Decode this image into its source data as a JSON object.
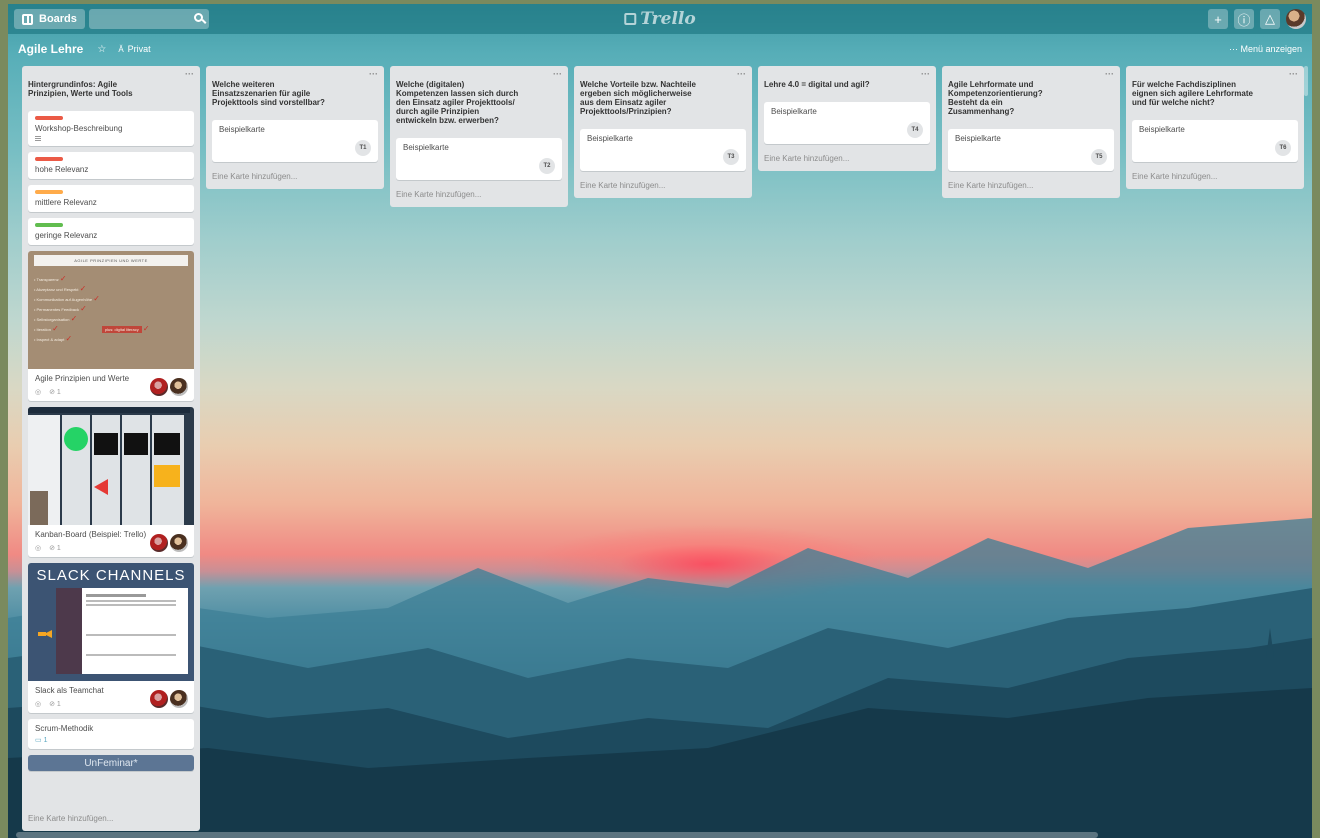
{
  "header": {
    "boards_label": "Boards",
    "search_value": "",
    "logo_text": "Trello",
    "plus_label": "+",
    "info_label": "ⓘ",
    "bell_label": "△"
  },
  "board": {
    "title": "Agile Lehre",
    "star": "☆",
    "privacy_icon": "Ă",
    "privacy": "Privat",
    "menu_link": "··· Menü anzeigen"
  },
  "colors": {
    "label_red": "#eb5a46",
    "label_orange": "#ffab4a",
    "label_green": "#61bd4f",
    "list_bg": "#e2e4e6"
  },
  "lists": [
    {
      "title": "Hintergrundinfos: Agile\nPrinzipien, Werte und Tools",
      "cards": {
        "workshop": "Workshop-Beschreibung",
        "hoch": "hohe Relevanz",
        "mittel": "mittlere Relevanz",
        "gering": "geringe Relevanz",
        "prinzipien_cover_title": "AGILE PRINZIPIEN UND WERTE",
        "prinzipien_items": [
          "Transparenz",
          "Akzeptanz und Respekt",
          "Kommunikation auf Augenhöhe",
          "Permanentes Feedback",
          "Selbstorganisation",
          "Iteration",
          "Inspect & adapt"
        ],
        "prinzipien_pill": "plus: digital literacy",
        "prinzipien": "Agile Prinzipien und Werte",
        "prinzipien_attach": "1",
        "kanban": "Kanban-Board (Beispiel: Trello)",
        "kanban_attach": "1",
        "slack_cover_title": "SLACK CHANNELS",
        "slack": "Slack als Teamchat",
        "slack_attach": "1",
        "scrum": "Scrum-Methodik",
        "scrum_comments": "1",
        "next_cover_title": "UnFeminar*"
      },
      "add": "Eine Karte hinzufügen..."
    },
    {
      "title": "Welche weiteren\nEinsatzszenarien für agile\nProjekttools sind vorstellbar?",
      "card": "Beispielkarte",
      "tag": "T1",
      "add": "Eine Karte hinzufügen..."
    },
    {
      "title": "Welche (digitalen)\nKompetenzen lassen sich durch\nden Einsatz agiler Projekttools/\ndurch agile Prinzipien\nentwickeln bzw. erwerben?",
      "card": "Beispielkarte",
      "tag": "T2",
      "add": "Eine Karte hinzufügen..."
    },
    {
      "title": "Welche Vorteile bzw. Nachteile\nergeben sich möglicherweise\naus dem Einsatz agiler\nProjekttools/Prinzipien?",
      "card": "Beispielkarte",
      "tag": "T3",
      "add": "Eine Karte hinzufügen..."
    },
    {
      "title": "Lehre 4.0 = digital und agil?",
      "card": "Beispielkarte",
      "tag": "T4",
      "add": "Eine Karte hinzufügen..."
    },
    {
      "title": "Agile Lehrformate und\nKompetenzorientierung?\nBesteht da ein\nZusammenhang?",
      "card": "Beispielkarte",
      "tag": "T5",
      "add": "Eine Karte hinzufügen..."
    },
    {
      "title": "Für welche Fachdisziplinen\neignen sich agilere Lehrformate\nund für welche nicht?",
      "card": "Beispielkarte",
      "tag": "T6",
      "add": "Eine Karte hinzufügen..."
    }
  ]
}
